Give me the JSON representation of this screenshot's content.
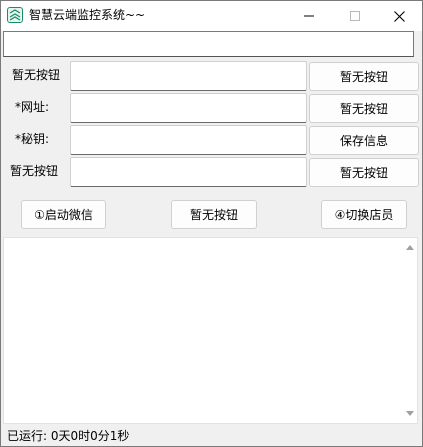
{
  "window": {
    "title": "智慧云端监控系统~~"
  },
  "rows": [
    {
      "label": "暂无按钮",
      "value": "",
      "button": "暂无按钮"
    },
    {
      "label": "*网址:",
      "value": "",
      "button": "暂无按钮"
    },
    {
      "label": "*秘钥:",
      "value": "",
      "button": "保存信息"
    },
    {
      "label": "暂无按钮",
      "value": "",
      "button": "暂无按钮"
    }
  ],
  "actions": {
    "start_wechat": "①启动微信",
    "no_button": "暂无按钮",
    "switch_store": "④切换店员"
  },
  "status": {
    "text": "已运行: 0天0时0分1秒"
  },
  "colors": {
    "icon_accent": "#1c8a6c"
  }
}
